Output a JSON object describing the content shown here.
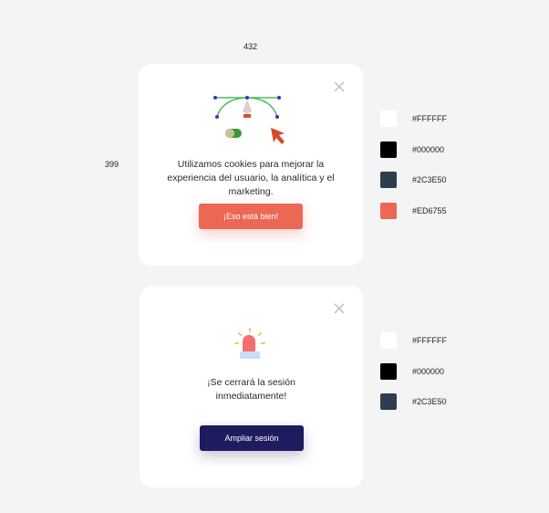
{
  "dimensions": {
    "width": "432",
    "height": "399"
  },
  "cookie_card": {
    "message": "Utilizamos cookies para mejorar la experiencia del usuario, la analítica y el marketing.",
    "button": "¡Eso está bien!",
    "button_color": "#ED6755"
  },
  "session_card": {
    "message_line1": "¡Se cerrará la sesión",
    "message_line2": "inmediatamente!",
    "button": "Ampliar sesión",
    "button_color": "#1E1B5E"
  },
  "palette1": [
    {
      "hex": "#FFFFFF"
    },
    {
      "hex": "#000000"
    },
    {
      "hex": "#2C3E50"
    },
    {
      "hex": "#ED6755"
    }
  ],
  "palette2": [
    {
      "hex": "#FFFFFF"
    },
    {
      "hex": "#000000"
    },
    {
      "hex": "#2C3E50"
    }
  ]
}
